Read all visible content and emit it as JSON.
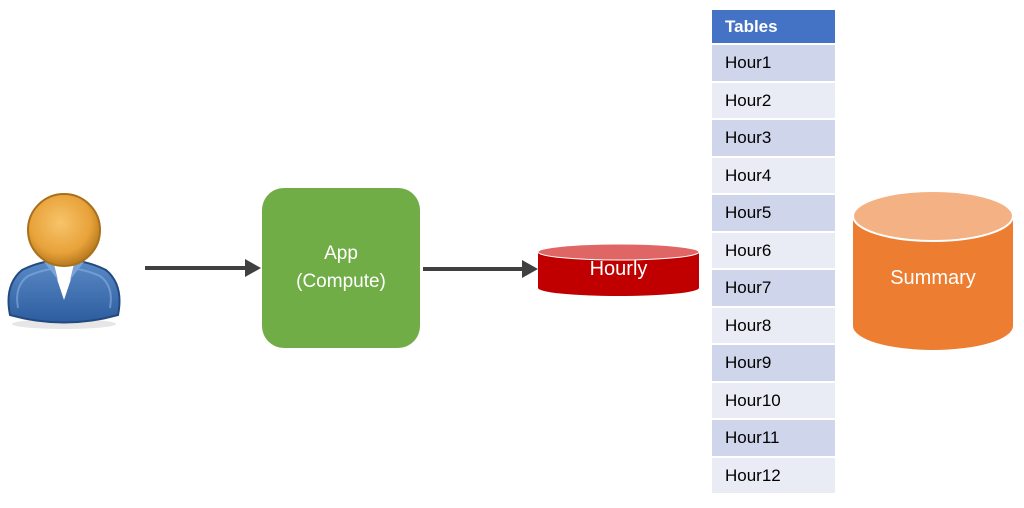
{
  "diagram": {
    "user": {
      "icon": "user-icon"
    },
    "app": {
      "line1": "App",
      "line2": "(Compute)",
      "color": "#70ad47"
    },
    "hourly": {
      "label": "Hourly",
      "color": "#c00000",
      "top_color": "#e06666"
    },
    "tables": {
      "header": "Tables",
      "header_color": "#4472c4",
      "rows": [
        "Hour1",
        "Hour2",
        "Hour3",
        "Hour4",
        "Hour5",
        "Hour6",
        "Hour7",
        "Hour8",
        "Hour9",
        "Hour10",
        "Hour11",
        "Hour12"
      ],
      "row_colors": [
        "#cfd5ea",
        "#e9ebf5"
      ]
    },
    "summary": {
      "label": "Summary",
      "color": "#ed7d31",
      "top_color": "#f4b183"
    },
    "arrows": [
      {
        "from": "user",
        "to": "app"
      },
      {
        "from": "app",
        "to": "hourly"
      }
    ]
  }
}
